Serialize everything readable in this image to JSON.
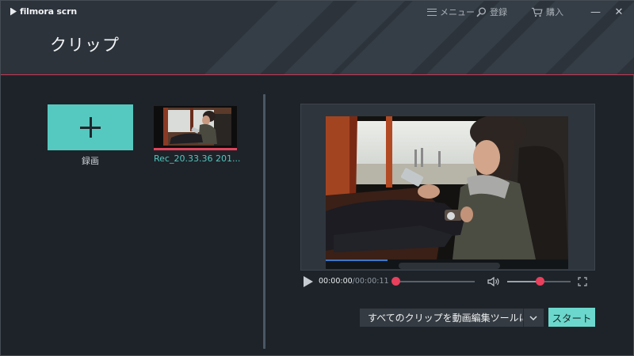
{
  "app": {
    "logo_text": "filmora scrn",
    "page_title": "クリップ"
  },
  "top_bar": {
    "menu_label": "メニュー",
    "login_label": "登録",
    "purchase_label": "購入",
    "minimize_glyph": "—",
    "close_glyph": "✕"
  },
  "clips_panel": {
    "record_label": "録画",
    "clips": [
      {
        "name": "Rec_20.33.36 201..."
      }
    ]
  },
  "player": {
    "current_time": "00:00:00",
    "total_time": "/00:00:11",
    "seek_progress": 0.0,
    "volume": 0.52
  },
  "actions": {
    "export_option": "すべてのクリップを動画編集ツールにエ",
    "start_label": "スタート"
  },
  "colors": {
    "accent_teal": "#55c9c0",
    "accent_red": "#e8405d",
    "header_bg": "#2c333b",
    "body_bg": "#1e2329"
  }
}
